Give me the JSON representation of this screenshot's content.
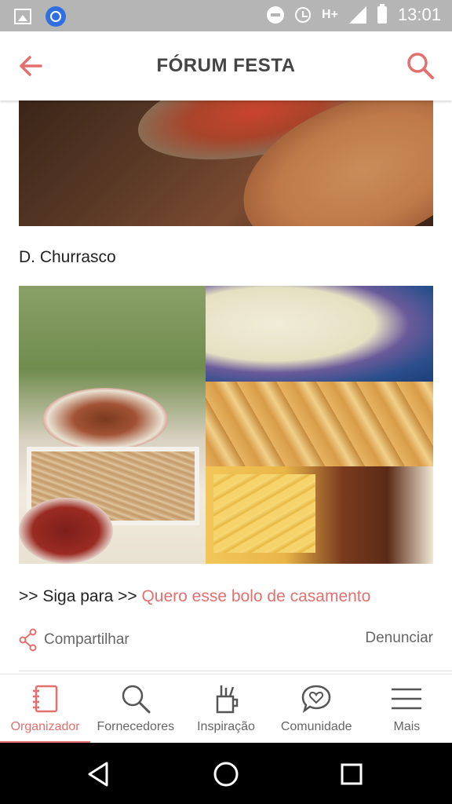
{
  "status_bar": {
    "time": "13:01",
    "network": "H+",
    "icons": [
      "image-icon",
      "app-icon",
      "do-not-disturb-icon",
      "alarm-icon",
      "signal-icon",
      "battery-icon"
    ]
  },
  "app_bar": {
    "title": "FÓRUM FESTA",
    "back_icon": "arrow-left-icon",
    "search_icon": "search-icon"
  },
  "post": {
    "top_image": "food-trays-photo",
    "section_label": "D. Churrasco",
    "collage_image": "churrasco-collage-photo",
    "nav_prefix": ">> Siga para >> ",
    "nav_link": "Quero esse bolo de casamento",
    "share_label": "Compartilhar",
    "report_label": "Denunciar"
  },
  "tabs": [
    {
      "label": "Organizador",
      "icon": "notebook-icon",
      "active": true
    },
    {
      "label": "Fornecedores",
      "icon": "search-icon",
      "active": false
    },
    {
      "label": "Inspiração",
      "icon": "brush-cup-icon",
      "active": false
    },
    {
      "label": "Comunidade",
      "icon": "chat-heart-icon",
      "active": false
    },
    {
      "label": "Mais",
      "icon": "menu-icon",
      "active": false
    }
  ],
  "colors": {
    "accent": "#e36f6f",
    "status_bar": "#b5b5b5",
    "text": "#222222",
    "muted": "#666666"
  }
}
